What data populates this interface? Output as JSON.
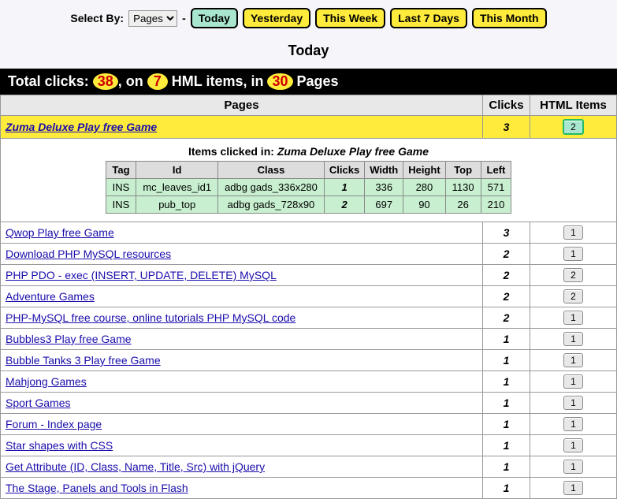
{
  "filter": {
    "label": "Select By:",
    "options": [
      "Pages"
    ],
    "selected": "Pages",
    "buttons": {
      "today": "Today",
      "yesterday": "Yesterday",
      "thisweek": "This Week",
      "last7": "Last 7 Days",
      "thismonth": "This Month"
    }
  },
  "page_title": "Today",
  "summary": {
    "prefix": "Total clicks:",
    "clicks": "38",
    "mid1": ", on",
    "hml_items": "7",
    "mid2": "HML items, in",
    "pages": "30",
    "suffix": "Pages"
  },
  "columns": {
    "pages": "Pages",
    "clicks": "Clicks",
    "html_items": "HTML Items"
  },
  "expanded": {
    "page": "Zuma Deluxe Play free Game",
    "clicks": "3",
    "items_btn": "2",
    "detail_header_prefix": "Items clicked in:",
    "detail_header_page": "Zuma Deluxe Play free Game",
    "detail_columns": [
      "Tag",
      "Id",
      "Class",
      "Clicks",
      "Width",
      "Height",
      "Top",
      "Left"
    ],
    "detail_rows": [
      {
        "tag": "INS",
        "id": "mc_leaves_id1",
        "class": "adbg gads_336x280",
        "clicks": "1",
        "width": "336",
        "height": "280",
        "top": "1130",
        "left": "571"
      },
      {
        "tag": "INS",
        "id": "pub_top",
        "class": "adbg gads_728x90",
        "clicks": "2",
        "width": "697",
        "height": "90",
        "top": "26",
        "left": "210"
      }
    ]
  },
  "rows": [
    {
      "page": "Qwop Play free Game",
      "clicks": "3",
      "items": "1"
    },
    {
      "page": "Download PHP MySQL resources",
      "clicks": "2",
      "items": "1"
    },
    {
      "page": "PHP PDO - exec (INSERT, UPDATE, DELETE) MySQL",
      "clicks": "2",
      "items": "2"
    },
    {
      "page": "Adventure Games",
      "clicks": "2",
      "items": "2"
    },
    {
      "page": "PHP-MySQL free course, online tutorials PHP MySQL code",
      "clicks": "2",
      "items": "1"
    },
    {
      "page": "Bubbles3 Play free Game",
      "clicks": "1",
      "items": "1"
    },
    {
      "page": "Bubble Tanks 3 Play free Game",
      "clicks": "1",
      "items": "1"
    },
    {
      "page": "Mahjong Games",
      "clicks": "1",
      "items": "1"
    },
    {
      "page": "Sport Games",
      "clicks": "1",
      "items": "1"
    },
    {
      "page": "Forum - Index page",
      "clicks": "1",
      "items": "1"
    },
    {
      "page": "Star shapes with CSS",
      "clicks": "1",
      "items": "1"
    },
    {
      "page": "Get Attribute (ID, Class, Name, Title, Src) with jQuery",
      "clicks": "1",
      "items": "1"
    },
    {
      "page": "The Stage, Panels and Tools in Flash",
      "clicks": "1",
      "items": "1"
    }
  ]
}
